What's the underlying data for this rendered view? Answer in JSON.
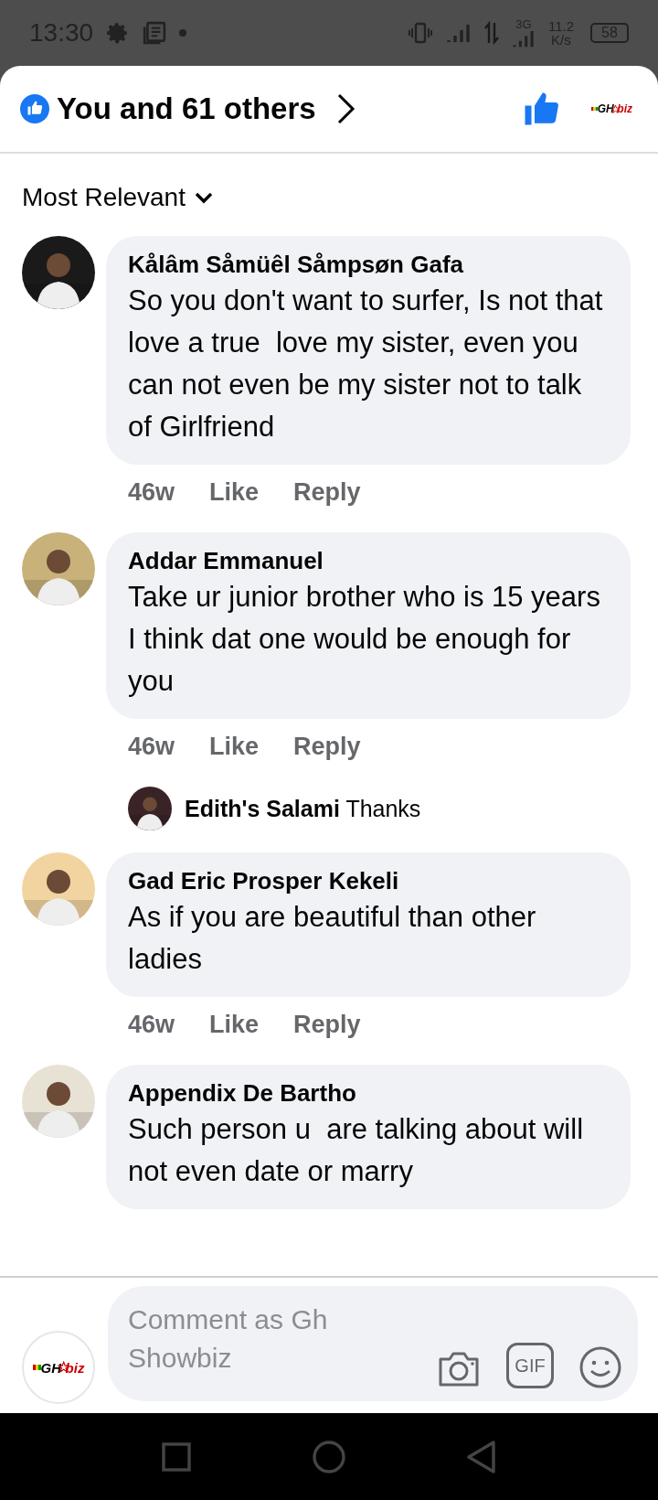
{
  "status_bar": {
    "time": "13:30",
    "network": "3G",
    "speed_value": "11.2",
    "speed_unit": "K/s",
    "battery": "58"
  },
  "header": {
    "title": "You and 61 others",
    "liked": true,
    "logo": {
      "left": "GH",
      "right": "biz"
    }
  },
  "sort": {
    "label": "Most Relevant"
  },
  "comments": [
    {
      "author": "Kålâm Såmüêl Såmpsøn Gafa",
      "text": "So you don't want to surfer, Is not that love a true  love my sister, even you can not even be my sister not to talk of Girlfriend",
      "time": "46w",
      "actions": [
        "Like",
        "Reply"
      ],
      "avatar": {
        "kind": "picture"
      }
    },
    {
      "author": "Addar Emmanuel",
      "text": "Take ur junior brother who is 15 years\nI think dat one would be enough for you",
      "time": "46w",
      "actions": [
        "Like",
        "Reply"
      ],
      "avatar": {
        "kind": "picture"
      },
      "replies": [
        {
          "author": "Edith's Salami",
          "text": "Thanks",
          "avatar": {
            "kind": "picture"
          }
        }
      ]
    },
    {
      "author": "Gad Eric Prosper Kekeli",
      "text": "As if you are beautiful than other ladies",
      "time": "46w",
      "actions": [
        "Like",
        "Reply"
      ],
      "avatar": {
        "kind": "picture"
      }
    },
    {
      "author": "Appendix De Bartho",
      "text": "Such person u  are talking about will not even date or marry",
      "avatar": {
        "kind": "picture"
      }
    }
  ],
  "composer": {
    "placeholder": "Comment as Gh Showbiz",
    "gif": "GIF",
    "logo": {
      "left": "GH",
      "right": "biz"
    }
  }
}
